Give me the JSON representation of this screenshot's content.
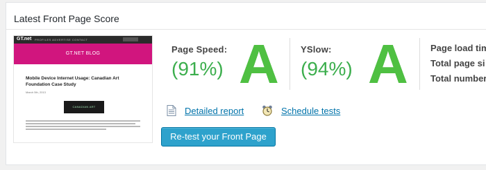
{
  "panel": {
    "title": "Latest Front Page Score"
  },
  "thumbnail": {
    "logo": "GT.net",
    "nav": "PROFILES  ADVERTISE  CONTACT",
    "banner": "GT.NET BLOG",
    "post_title": "Mobile Device Internet Usage: Canadian Art Foundation Case Study",
    "post_date": "March 5th, 2013",
    "image_text": "CANADIAN ART"
  },
  "page_speed": {
    "label": "Page Speed:",
    "percent": "(91%)",
    "grade": "A",
    "value": 91
  },
  "yslow": {
    "label": "YSlow:",
    "percent": "(94%)",
    "grade": "A",
    "value": 94
  },
  "metrics": {
    "load_time_label": "Page load tim",
    "page_size_label": "Total page si",
    "requests_label": "Total number"
  },
  "actions": {
    "detailed_report": "Detailed report",
    "schedule_tests": "Schedule tests",
    "retest": "Re-test your Front Page"
  },
  "colors": {
    "grade_green": "#4fc042",
    "percent_green": "#3cae4d",
    "button_blue": "#2ea2cc",
    "banner_pink": "#d1157e"
  }
}
